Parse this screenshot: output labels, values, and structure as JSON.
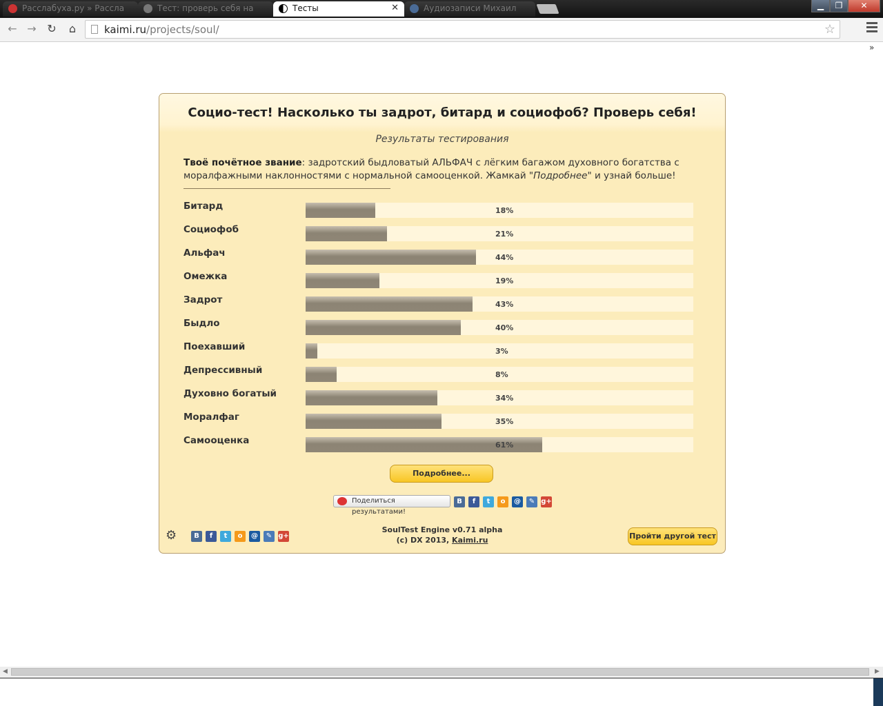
{
  "browser": {
    "tabs": [
      {
        "label": "Расслабуха.ру » Рассла",
        "state": "inactive"
      },
      {
        "label": "Тест: проверь себя на",
        "state": "inactive"
      },
      {
        "label": "Тесты",
        "state": "active"
      },
      {
        "label": "Аудиозаписи Михаил",
        "state": "inactive"
      }
    ],
    "address": {
      "host": "kaimi.ru",
      "path": "/projects/soul/"
    }
  },
  "test": {
    "title": "Социо-тест! Насколько ты задрот, битард и социофоб? Проверь себя!",
    "subtitle": "Результаты тестирования",
    "rank_label": "Твоё почётное звание",
    "rank_text": ": задротский быдловатый АЛЬФАЧ с лёгким багажом духовного богатства с моралфажными наклонностями с нормальной самооценкой. Жамкай \"",
    "rank_more_word": "Подробнее",
    "rank_tail": "\" и узнай больше!",
    "results": [
      {
        "label": "Битард",
        "value": 18,
        "value_text": "18%"
      },
      {
        "label": "Социофоб",
        "value": 21,
        "value_text": "21%"
      },
      {
        "label": "Альфач",
        "value": 44,
        "value_text": "44%"
      },
      {
        "label": "Омежка",
        "value": 19,
        "value_text": "19%"
      },
      {
        "label": "Задрот",
        "value": 43,
        "value_text": "43%"
      },
      {
        "label": "Быдло",
        "value": 40,
        "value_text": "40%"
      },
      {
        "label": "Поехавший",
        "value": 3,
        "value_text": "3%"
      },
      {
        "label": "Депрессивный",
        "value": 8,
        "value_text": "8%"
      },
      {
        "label": "Духовно богатый",
        "value": 34,
        "value_text": "34%"
      },
      {
        "label": "Моралфаг",
        "value": 35,
        "value_text": "35%"
      },
      {
        "label": "Самооценка",
        "value": 61,
        "value_text": "61%"
      }
    ],
    "more_button": "Подробнее...",
    "share_button": "Поделиться результатами!",
    "share_icons": [
      {
        "name": "vkontakte-icon",
        "glyph": "В",
        "color": "#4a6b96"
      },
      {
        "name": "facebook-icon",
        "glyph": "f",
        "color": "#3b5998"
      },
      {
        "name": "twitter-icon",
        "glyph": "t",
        "color": "#3fa9dc"
      },
      {
        "name": "odnoklassniki-icon",
        "glyph": "o",
        "color": "#f59a1b"
      },
      {
        "name": "mailru-icon",
        "glyph": "@",
        "color": "#1a5aa0"
      },
      {
        "name": "livejournal-icon",
        "glyph": "✎",
        "color": "#4b7bb8"
      },
      {
        "name": "googleplus-icon",
        "glyph": "g+",
        "color": "#d34836"
      }
    ],
    "footer": {
      "engine": "SoulTest Engine v0.71 alpha",
      "copyright": "(c) DX 2013, ",
      "link": "Kaimi.ru"
    },
    "other_button": "Пройти другой тест"
  }
}
